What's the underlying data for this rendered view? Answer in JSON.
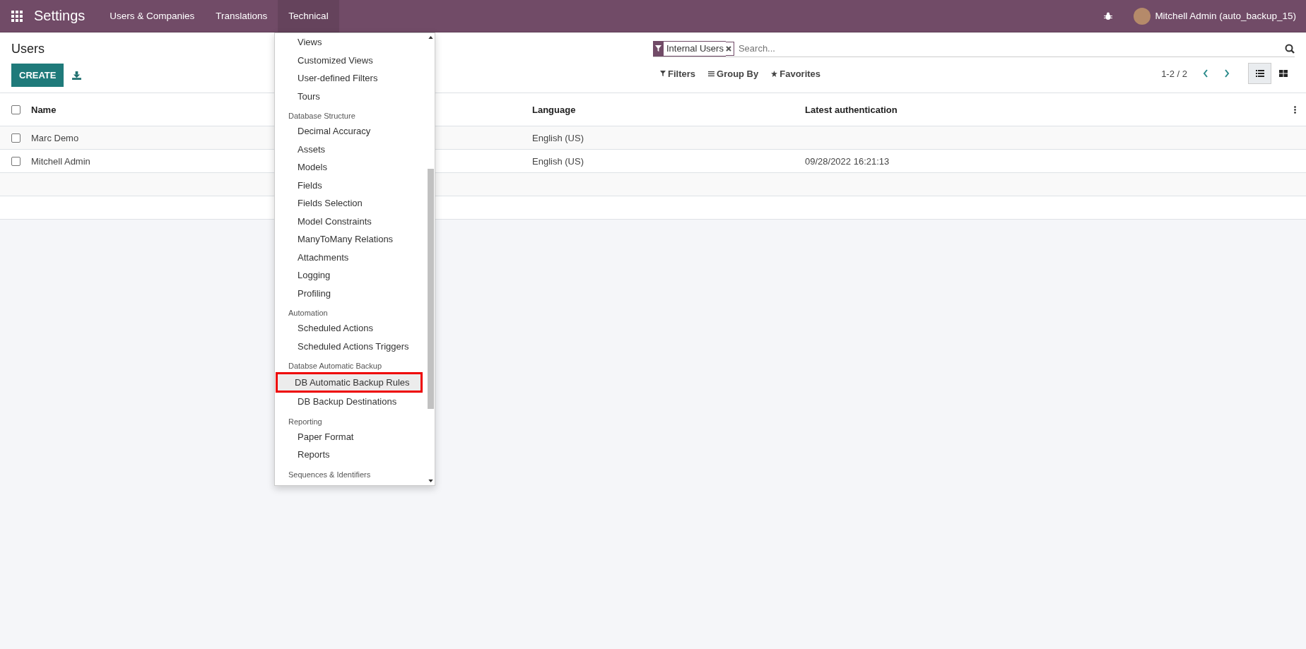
{
  "navbar": {
    "app_title": "Settings",
    "menus": [
      {
        "label": "Users & Companies",
        "selected": false
      },
      {
        "label": "Translations",
        "selected": false
      },
      {
        "label": "Technical",
        "selected": true
      }
    ],
    "user": "Mitchell Admin (auto_backup_15)"
  },
  "control_panel": {
    "title": "Users",
    "create_button": "CREATE",
    "facet": "Internal Users",
    "search_placeholder": "Search...",
    "filters": "Filters",
    "group_by": "Group By",
    "favorites": "Favorites",
    "pager": "1-2 / 2",
    "views": [
      {
        "kind": "list",
        "selected": true
      },
      {
        "kind": "kanban",
        "selected": false
      }
    ]
  },
  "table": {
    "select_all_checked": false,
    "columns": [
      "Name",
      "Language",
      "Latest authentication"
    ],
    "rows": [
      {
        "name": "Marc Demo",
        "language": "English (US)",
        "latest_authentication": "",
        "checked": false
      },
      {
        "name": "Mitchell Admin",
        "language": "English (US)",
        "latest_authentication": "09/28/2022 16:21:13",
        "checked": false
      }
    ]
  },
  "dropdown": {
    "sections": [
      {
        "items": [
          {
            "label": "Views",
            "selected": false
          },
          {
            "label": "Customized Views",
            "selected": false
          },
          {
            "label": "User-defined Filters",
            "selected": false
          },
          {
            "label": "Tours",
            "selected": false
          }
        ]
      },
      {
        "header": "Database Structure",
        "items": [
          {
            "label": "Decimal Accuracy",
            "selected": false
          },
          {
            "label": "Assets",
            "selected": false
          },
          {
            "label": "Models",
            "selected": false
          },
          {
            "label": "Fields",
            "selected": false
          },
          {
            "label": "Fields Selection",
            "selected": false
          },
          {
            "label": "Model Constraints",
            "selected": false
          },
          {
            "label": "ManyToMany Relations",
            "selected": false
          },
          {
            "label": "Attachments",
            "selected": false
          },
          {
            "label": "Logging",
            "selected": false
          },
          {
            "label": "Profiling",
            "selected": false
          }
        ]
      },
      {
        "header": "Automation",
        "items": [
          {
            "label": "Scheduled Actions",
            "selected": false
          },
          {
            "label": "Scheduled Actions Triggers",
            "selected": false
          }
        ]
      },
      {
        "header": "Databse Automatic Backup",
        "items": [
          {
            "label": "DB Automatic Backup Rules",
            "selected": true
          },
          {
            "label": "DB Backup Destinations",
            "selected": false
          }
        ]
      },
      {
        "header": "Reporting",
        "items": [
          {
            "label": "Paper Format",
            "selected": false
          },
          {
            "label": "Reports",
            "selected": false
          }
        ]
      },
      {
        "header": "Sequences & Identifiers"
      }
    ]
  }
}
